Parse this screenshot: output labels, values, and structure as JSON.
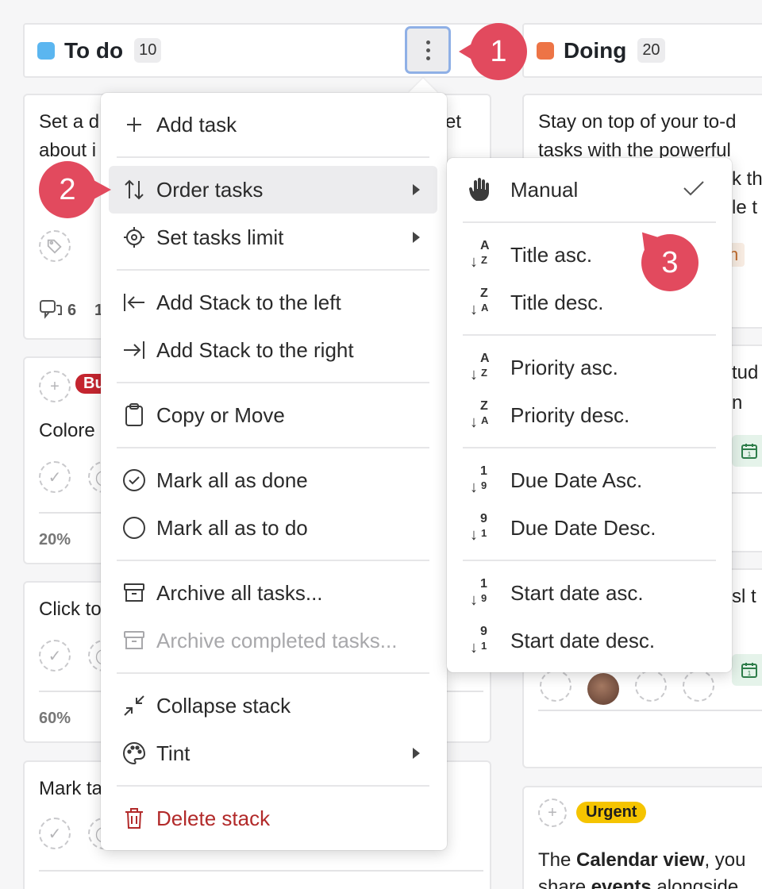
{
  "stacks": {
    "todo": {
      "title": "To do",
      "count": "10",
      "color": "#5bb6f0"
    },
    "doing": {
      "title": "Doing",
      "count": "20",
      "color": "#ed7446"
    }
  },
  "todo_cards": {
    "card1": {
      "text_line1": "Set a d",
      "text_line1_right": "et",
      "text_line2": "about i",
      "comments": "6",
      "comments_extra": "1"
    },
    "card2": {
      "tag": "Bu",
      "text": "Colore",
      "percent": "20%"
    },
    "card3": {
      "text": "Click to",
      "percent": "60%"
    },
    "card4": {
      "text": "Mark ta"
    }
  },
  "doing_cards": {
    "card1": {
      "line1": "Stay on top of your to-d",
      "line2": "tasks with the powerful",
      "line3": "k th",
      "line4": "le t",
      "chip": "n"
    },
    "card2": {
      "line1": "tud",
      "line2": "n"
    },
    "card3": {
      "line1": "sl t"
    },
    "card4": {
      "tag": "Urgent",
      "line1_a": "The ",
      "line1_b": "Calendar view",
      "line1_c": ", you",
      "line2_a": "share ",
      "line2_b": "events",
      "line2_c": " alongside"
    }
  },
  "menu": {
    "items": [
      {
        "label": "Add task",
        "icon": "plus-icon"
      },
      {
        "label": "Order tasks",
        "icon": "sort-arrows-icon",
        "submenu": true,
        "highlighted": true
      },
      {
        "label": "Set tasks limit",
        "icon": "target-icon",
        "submenu": true
      },
      {
        "label": "Add Stack to the left",
        "icon": "arrow-left-bar-icon"
      },
      {
        "label": "Add Stack to the right",
        "icon": "arrow-right-bar-icon"
      },
      {
        "label": "Copy or Move",
        "icon": "clipboard-icon"
      },
      {
        "label": "Mark all as done",
        "icon": "check-circle-icon"
      },
      {
        "label": "Mark all as to do",
        "icon": "circle-icon"
      },
      {
        "label": "Archive all tasks...",
        "icon": "archive-icon"
      },
      {
        "label": "Archive completed tasks...",
        "icon": "archive-icon",
        "disabled": true
      },
      {
        "label": "Collapse stack",
        "icon": "collapse-icon"
      },
      {
        "label": "Tint",
        "icon": "palette-icon",
        "submenu": true
      },
      {
        "label": "Delete stack",
        "icon": "trash-icon",
        "danger": true
      }
    ]
  },
  "submenu": {
    "items": [
      {
        "label": "Manual",
        "icon": "hand-icon",
        "selected": true
      },
      {
        "label": "Title asc.",
        "glyph_top": "A",
        "glyph_bottom": "Z"
      },
      {
        "label": "Title desc.",
        "glyph_top": "Z",
        "glyph_bottom": "A"
      },
      {
        "label": "Priority asc.",
        "glyph_top": "A",
        "glyph_bottom": "Z"
      },
      {
        "label": "Priority desc.",
        "glyph_top": "Z",
        "glyph_bottom": "A"
      },
      {
        "label": "Due Date Asc.",
        "glyph_top": "1",
        "glyph_bottom": "9"
      },
      {
        "label": "Due Date Desc.",
        "glyph_top": "9",
        "glyph_bottom": "1"
      },
      {
        "label": "Start date asc.",
        "glyph_top": "1",
        "glyph_bottom": "9"
      },
      {
        "label": "Start date desc.",
        "glyph_top": "9",
        "glyph_bottom": "1"
      }
    ]
  },
  "markers": {
    "m1": "1",
    "m2": "2",
    "m3": "3",
    "color": "#e24a5e"
  },
  "colors": {
    "danger": "#b22a2a",
    "accent_border": "#8fb0e6"
  }
}
